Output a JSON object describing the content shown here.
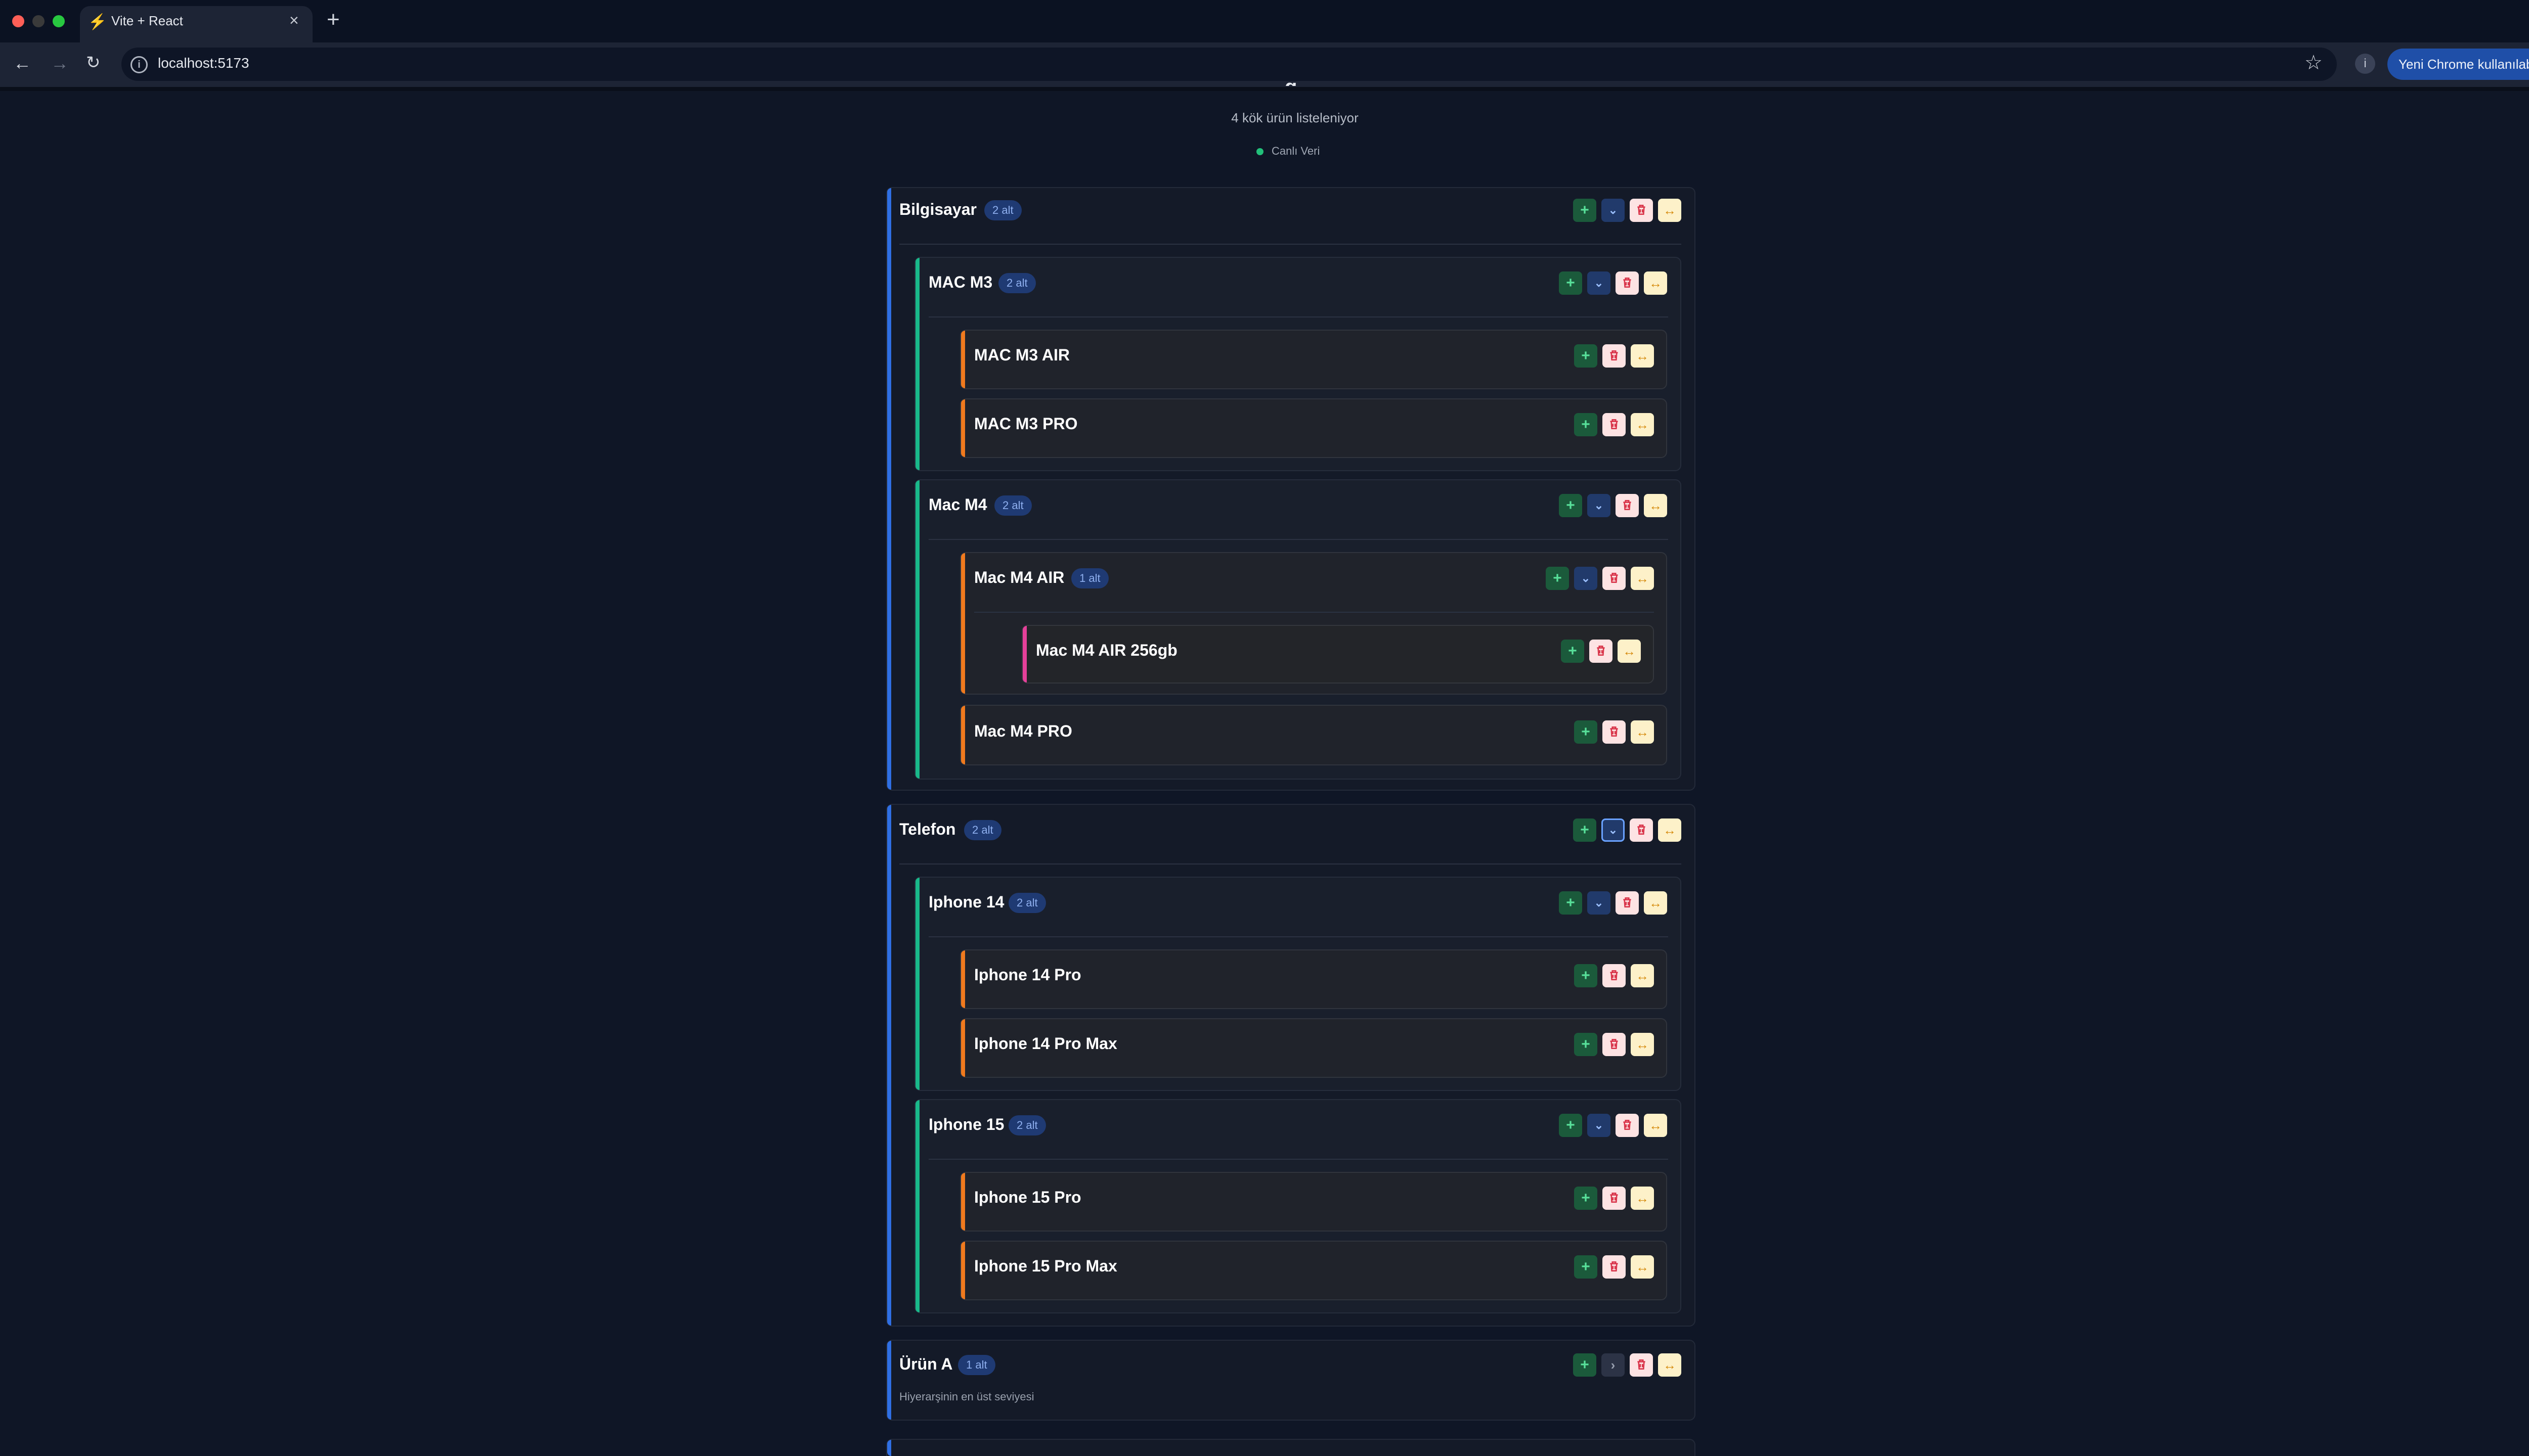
{
  "browser": {
    "tab_title": "Vite + React",
    "url": "localhost:5173",
    "update_label": "Yeni Chrome kullanılabilir",
    "new_tab_label": "+",
    "tab_close_label": "×",
    "menu_dots": "⋮",
    "tab_menu_glyph": "⌄",
    "traffic_colors": {
      "close": "#ff5f57",
      "minimize": "#3a3a3a",
      "maximize": "#28c840"
    }
  },
  "header": {
    "subtitle": "4 kök ürün listeleniyor",
    "live_label": "Canlı Veri",
    "title_fragment": "g"
  },
  "icons": {
    "add": "+",
    "expand": "⌄",
    "collapsed": "›",
    "move": "↔"
  },
  "tree": {
    "bilgisayar": {
      "name": "Bilgisayar",
      "badge": "2 alt"
    },
    "mac_m3": {
      "name": "MAC M3",
      "badge": "2 alt"
    },
    "mac_m3_air": {
      "name": "MAC M3 AIR"
    },
    "mac_m3_pro": {
      "name": "MAC M3 PRO"
    },
    "mac_m4": {
      "name": "Mac M4",
      "badge": "2 alt"
    },
    "mac_m4_air": {
      "name": "Mac M4 AIR",
      "badge": "1 alt"
    },
    "mac_m4_air_256": {
      "name": "Mac M4 AIR 256gb"
    },
    "mac_m4_pro": {
      "name": "Mac M4 PRO"
    },
    "telefon": {
      "name": "Telefon",
      "badge": "2 alt"
    },
    "iphone14": {
      "name": "Iphone 14",
      "badge": "2 alt"
    },
    "iphone14_pro": {
      "name": "Iphone 14 Pro"
    },
    "iphone14_pro_max": {
      "name": "Iphone 14 Pro Max"
    },
    "iphone15": {
      "name": "Iphone 15",
      "badge": "2 alt"
    },
    "iphone15_pro": {
      "name": "Iphone 15 Pro"
    },
    "iphone15_pro_max": {
      "name": "Iphone 15 Pro Max"
    },
    "urun_a": {
      "name": "Ürün A",
      "badge": "1 alt",
      "description": "Hiyerarşinin en üst seviyesi"
    }
  },
  "colors": {
    "level0": "#2f6fe4",
    "level1": "#19b88a",
    "level2": "#f07a1e",
    "level3": "#e5409a",
    "scrollbar": "#6c3ed6"
  }
}
